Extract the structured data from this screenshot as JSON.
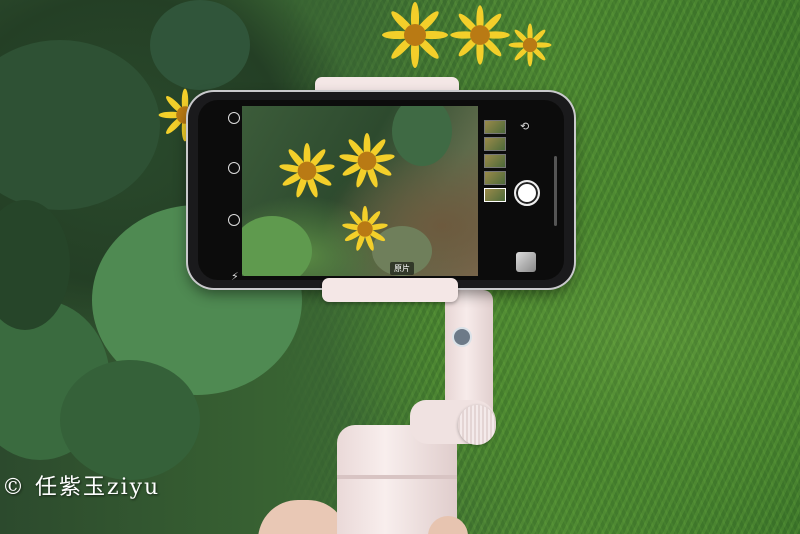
{
  "image": {
    "watermark": "© 任紫玉ziyu",
    "camera_mode_label": "原片"
  },
  "icons": [
    "flash-icon",
    "timer-icon",
    "live-photo-icon",
    "camera-switch-icon",
    "shutter-button-icon"
  ],
  "colors": {
    "gimbal": "#f4e7e6",
    "flower": "#f3cf2a",
    "foliage": "#4d8a31"
  }
}
